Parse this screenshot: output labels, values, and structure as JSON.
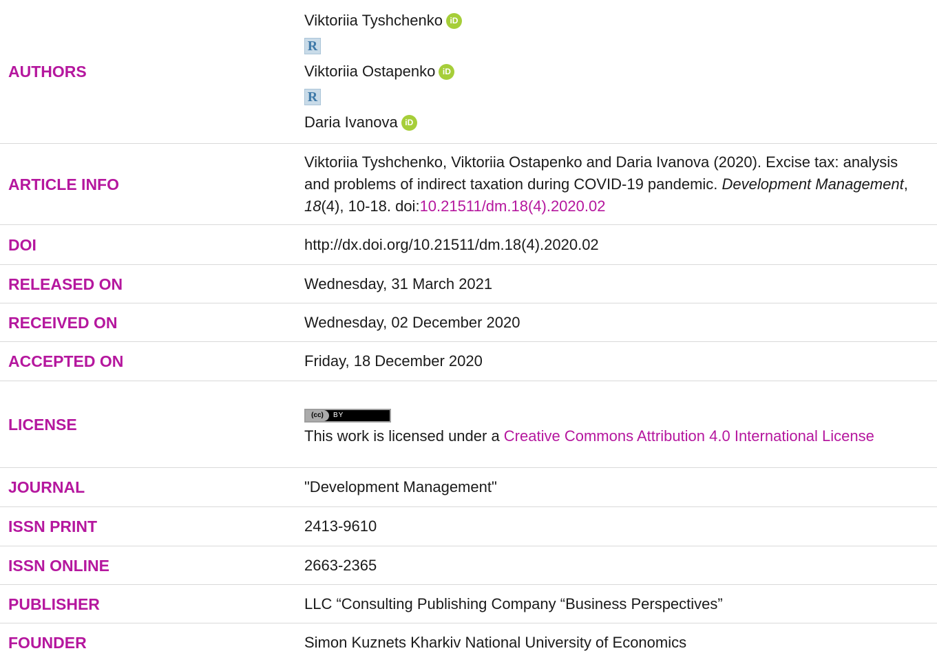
{
  "labels": {
    "authors": "AUTHORS",
    "article_info": "ARTICLE INFO",
    "doi": "DOI",
    "released_on": "RELEASED ON",
    "received_on": "RECEIVED ON",
    "accepted_on": "ACCEPTED ON",
    "license": "LICENSE",
    "journal": "JOURNAL",
    "issn_print": "ISSN PRINT",
    "issn_online": "ISSN ONLINE",
    "publisher": "PUBLISHER",
    "founder": "FOUNDER"
  },
  "authors": [
    "Viktoriia Tyshchenko",
    "Viktoriia Ostapenko",
    "Daria Ivanova"
  ],
  "icons": {
    "orcid": "iD",
    "researchgate": "R",
    "cc_logo": "(cc)",
    "cc_by": "BY"
  },
  "article_info": {
    "text_prefix": "Viktoriia Tyshchenko, Viktoriia Ostapenko and Daria Ivanova (2020). Excise tax: analysis and problems of indirect taxation during COVID-19 pandemic. ",
    "journal_name": "Development Management",
    "sep1": ", ",
    "volume": "18",
    "issue_pages": "(4), 10-18. doi:",
    "doi_link": "10.21511/dm.18(4).2020.02"
  },
  "doi": "http://dx.doi.org/10.21511/dm.18(4).2020.02",
  "released_on": "Wednesday, 31 March 2021",
  "received_on": "Wednesday, 02 December 2020",
  "accepted_on": "Friday, 18 December 2020",
  "license": {
    "text": "This work is licensed under a ",
    "link": "Creative Commons Attribution 4.0 International License"
  },
  "journal": "\"Development Management\"",
  "issn_print": "2413-9610",
  "issn_online": "2663-2365",
  "publisher": "LLC “Consulting Publishing Company “Business Perspectives”",
  "founder": "Simon Kuznets Kharkiv National University of Economics",
  "colors": {
    "accent": "#b5179e",
    "orcid": "#a6ce39",
    "divider": "#d9d9d9"
  }
}
